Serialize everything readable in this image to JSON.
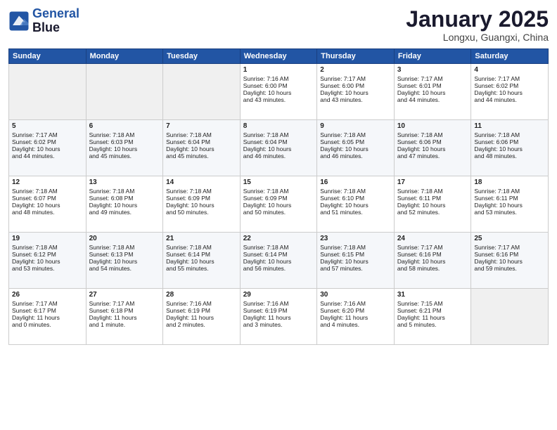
{
  "header": {
    "logo_line1": "General",
    "logo_line2": "Blue",
    "title": "January 2025",
    "subtitle": "Longxu, Guangxi, China"
  },
  "days_of_week": [
    "Sunday",
    "Monday",
    "Tuesday",
    "Wednesday",
    "Thursday",
    "Friday",
    "Saturday"
  ],
  "weeks": [
    [
      {
        "num": "",
        "empty": true
      },
      {
        "num": "",
        "empty": true
      },
      {
        "num": "",
        "empty": true
      },
      {
        "num": "1",
        "line1": "Sunrise: 7:16 AM",
        "line2": "Sunset: 6:00 PM",
        "line3": "Daylight: 10 hours",
        "line4": "and 43 minutes."
      },
      {
        "num": "2",
        "line1": "Sunrise: 7:17 AM",
        "line2": "Sunset: 6:00 PM",
        "line3": "Daylight: 10 hours",
        "line4": "and 43 minutes."
      },
      {
        "num": "3",
        "line1": "Sunrise: 7:17 AM",
        "line2": "Sunset: 6:01 PM",
        "line3": "Daylight: 10 hours",
        "line4": "and 44 minutes."
      },
      {
        "num": "4",
        "line1": "Sunrise: 7:17 AM",
        "line2": "Sunset: 6:02 PM",
        "line3": "Daylight: 10 hours",
        "line4": "and 44 minutes."
      }
    ],
    [
      {
        "num": "5",
        "line1": "Sunrise: 7:17 AM",
        "line2": "Sunset: 6:02 PM",
        "line3": "Daylight: 10 hours",
        "line4": "and 44 minutes."
      },
      {
        "num": "6",
        "line1": "Sunrise: 7:18 AM",
        "line2": "Sunset: 6:03 PM",
        "line3": "Daylight: 10 hours",
        "line4": "and 45 minutes."
      },
      {
        "num": "7",
        "line1": "Sunrise: 7:18 AM",
        "line2": "Sunset: 6:04 PM",
        "line3": "Daylight: 10 hours",
        "line4": "and 45 minutes."
      },
      {
        "num": "8",
        "line1": "Sunrise: 7:18 AM",
        "line2": "Sunset: 6:04 PM",
        "line3": "Daylight: 10 hours",
        "line4": "and 46 minutes."
      },
      {
        "num": "9",
        "line1": "Sunrise: 7:18 AM",
        "line2": "Sunset: 6:05 PM",
        "line3": "Daylight: 10 hours",
        "line4": "and 46 minutes."
      },
      {
        "num": "10",
        "line1": "Sunrise: 7:18 AM",
        "line2": "Sunset: 6:06 PM",
        "line3": "Daylight: 10 hours",
        "line4": "and 47 minutes."
      },
      {
        "num": "11",
        "line1": "Sunrise: 7:18 AM",
        "line2": "Sunset: 6:06 PM",
        "line3": "Daylight: 10 hours",
        "line4": "and 48 minutes."
      }
    ],
    [
      {
        "num": "12",
        "line1": "Sunrise: 7:18 AM",
        "line2": "Sunset: 6:07 PM",
        "line3": "Daylight: 10 hours",
        "line4": "and 48 minutes."
      },
      {
        "num": "13",
        "line1": "Sunrise: 7:18 AM",
        "line2": "Sunset: 6:08 PM",
        "line3": "Daylight: 10 hours",
        "line4": "and 49 minutes."
      },
      {
        "num": "14",
        "line1": "Sunrise: 7:18 AM",
        "line2": "Sunset: 6:09 PM",
        "line3": "Daylight: 10 hours",
        "line4": "and 50 minutes."
      },
      {
        "num": "15",
        "line1": "Sunrise: 7:18 AM",
        "line2": "Sunset: 6:09 PM",
        "line3": "Daylight: 10 hours",
        "line4": "and 50 minutes."
      },
      {
        "num": "16",
        "line1": "Sunrise: 7:18 AM",
        "line2": "Sunset: 6:10 PM",
        "line3": "Daylight: 10 hours",
        "line4": "and 51 minutes."
      },
      {
        "num": "17",
        "line1": "Sunrise: 7:18 AM",
        "line2": "Sunset: 6:11 PM",
        "line3": "Daylight: 10 hours",
        "line4": "and 52 minutes."
      },
      {
        "num": "18",
        "line1": "Sunrise: 7:18 AM",
        "line2": "Sunset: 6:11 PM",
        "line3": "Daylight: 10 hours",
        "line4": "and 53 minutes."
      }
    ],
    [
      {
        "num": "19",
        "line1": "Sunrise: 7:18 AM",
        "line2": "Sunset: 6:12 PM",
        "line3": "Daylight: 10 hours",
        "line4": "and 53 minutes."
      },
      {
        "num": "20",
        "line1": "Sunrise: 7:18 AM",
        "line2": "Sunset: 6:13 PM",
        "line3": "Daylight: 10 hours",
        "line4": "and 54 minutes."
      },
      {
        "num": "21",
        "line1": "Sunrise: 7:18 AM",
        "line2": "Sunset: 6:14 PM",
        "line3": "Daylight: 10 hours",
        "line4": "and 55 minutes."
      },
      {
        "num": "22",
        "line1": "Sunrise: 7:18 AM",
        "line2": "Sunset: 6:14 PM",
        "line3": "Daylight: 10 hours",
        "line4": "and 56 minutes."
      },
      {
        "num": "23",
        "line1": "Sunrise: 7:18 AM",
        "line2": "Sunset: 6:15 PM",
        "line3": "Daylight: 10 hours",
        "line4": "and 57 minutes."
      },
      {
        "num": "24",
        "line1": "Sunrise: 7:17 AM",
        "line2": "Sunset: 6:16 PM",
        "line3": "Daylight: 10 hours",
        "line4": "and 58 minutes."
      },
      {
        "num": "25",
        "line1": "Sunrise: 7:17 AM",
        "line2": "Sunset: 6:16 PM",
        "line3": "Daylight: 10 hours",
        "line4": "and 59 minutes."
      }
    ],
    [
      {
        "num": "26",
        "line1": "Sunrise: 7:17 AM",
        "line2": "Sunset: 6:17 PM",
        "line3": "Daylight: 11 hours",
        "line4": "and 0 minutes."
      },
      {
        "num": "27",
        "line1": "Sunrise: 7:17 AM",
        "line2": "Sunset: 6:18 PM",
        "line3": "Daylight: 11 hours",
        "line4": "and 1 minute."
      },
      {
        "num": "28",
        "line1": "Sunrise: 7:16 AM",
        "line2": "Sunset: 6:19 PM",
        "line3": "Daylight: 11 hours",
        "line4": "and 2 minutes."
      },
      {
        "num": "29",
        "line1": "Sunrise: 7:16 AM",
        "line2": "Sunset: 6:19 PM",
        "line3": "Daylight: 11 hours",
        "line4": "and 3 minutes."
      },
      {
        "num": "30",
        "line1": "Sunrise: 7:16 AM",
        "line2": "Sunset: 6:20 PM",
        "line3": "Daylight: 11 hours",
        "line4": "and 4 minutes."
      },
      {
        "num": "31",
        "line1": "Sunrise: 7:15 AM",
        "line2": "Sunset: 6:21 PM",
        "line3": "Daylight: 11 hours",
        "line4": "and 5 minutes."
      },
      {
        "num": "",
        "empty": true
      }
    ]
  ]
}
